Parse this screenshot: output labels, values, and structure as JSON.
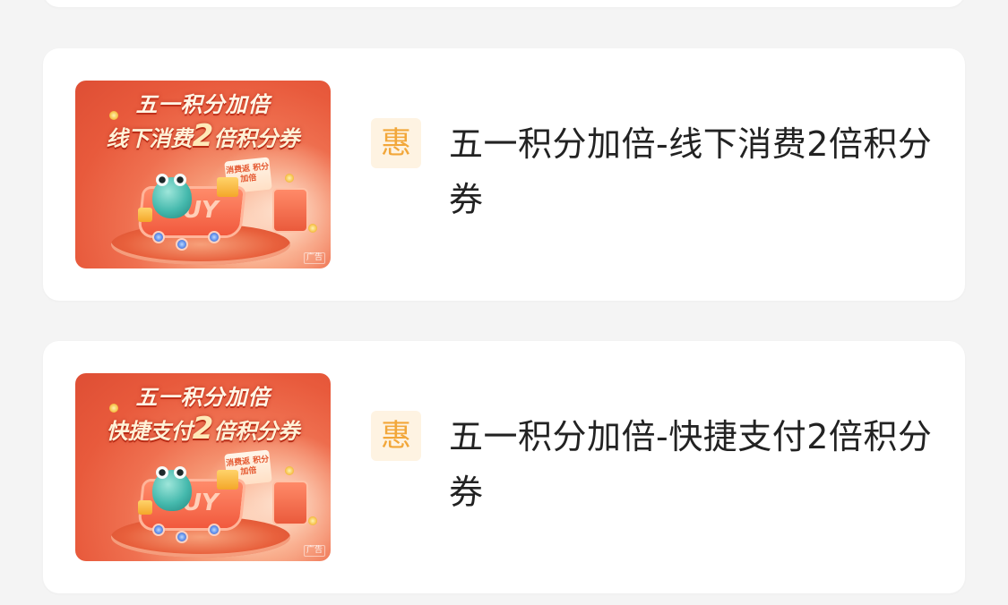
{
  "offers": [
    {
      "badge": "惠",
      "title": "五一积分加倍-线下消费2倍积分券",
      "banner": {
        "title": "五一积分加倍",
        "sub_prefix": "线下消费",
        "sub_number": "2",
        "sub_suffix": "倍积分券",
        "note": "消费返 积分加倍",
        "cart_text": "BUY",
        "ad_label": "广告"
      }
    },
    {
      "badge": "惠",
      "title": "五一积分加倍-快捷支付2倍积分券",
      "banner": {
        "title": "五一积分加倍",
        "sub_prefix": "快捷支付",
        "sub_number": "2",
        "sub_suffix": "倍积分券",
        "note": "消费返 积分加倍",
        "cart_text": "BUY",
        "ad_label": "广告"
      }
    }
  ],
  "colors": {
    "page_bg": "#f4f4f4",
    "card_bg": "#ffffff",
    "badge_bg": "#fef3e2",
    "badge_text": "#f2a73a",
    "title_text": "#222222",
    "banner_red": "#e85a3c"
  },
  "icons": {
    "badge": "hui-discount-icon"
  }
}
